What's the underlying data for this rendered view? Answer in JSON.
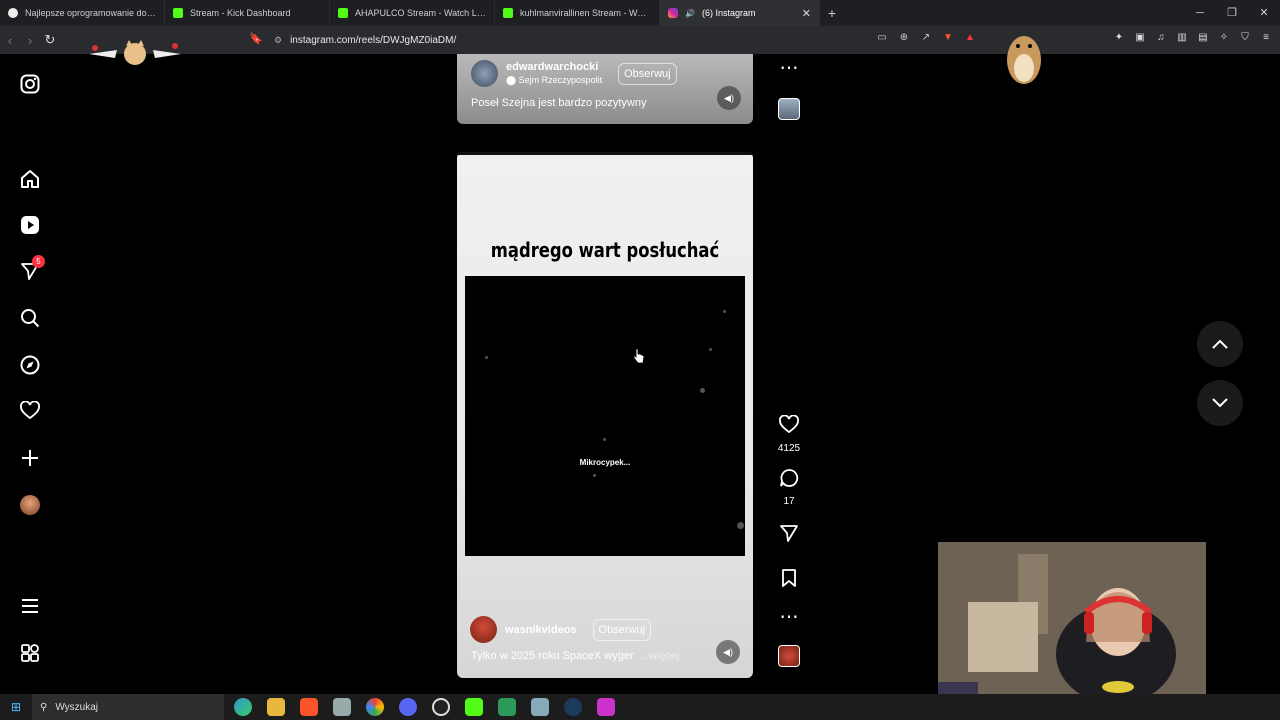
{
  "browser": {
    "tabs": [
      {
        "title": "Najlepsze oprogramowanie do ulep",
        "active": false
      },
      {
        "title": "Stream - Kick Dashboard",
        "active": false
      },
      {
        "title": "AHAPULCO Stream - Watch Live on K",
        "active": false
      },
      {
        "title": "kuhlmanvirallinen Stream - Watch Li",
        "active": false
      },
      {
        "title": "(6) Instagram",
        "active": true
      }
    ],
    "url": "instagram.com/reels/DWJgMZ0iaDM/"
  },
  "sidebar": {
    "notifications_badge": "5"
  },
  "reel_prev": {
    "username": "edwardwarchocki",
    "location": "Sejm Rzeczypospolit",
    "follow_label": "Obserwuj",
    "caption": "Poseł Szejna jest bardzo pozytywny"
  },
  "reel": {
    "headline": "mądrego wart posłuchać",
    "video_caption": "Mikrocypek...",
    "username": "wasnikvideos",
    "follow_label": "Obserwuj",
    "caption": "Tylko w 2025 roku SpaceX wyger",
    "more_label": "... więcej",
    "likes": "4125",
    "comments": "17"
  },
  "taskbar": {
    "search_placeholder": "Wyszukaj"
  },
  "colors": {
    "background": "#000000",
    "badge": "#ff3040",
    "taskbar": "#1c1c1c"
  }
}
